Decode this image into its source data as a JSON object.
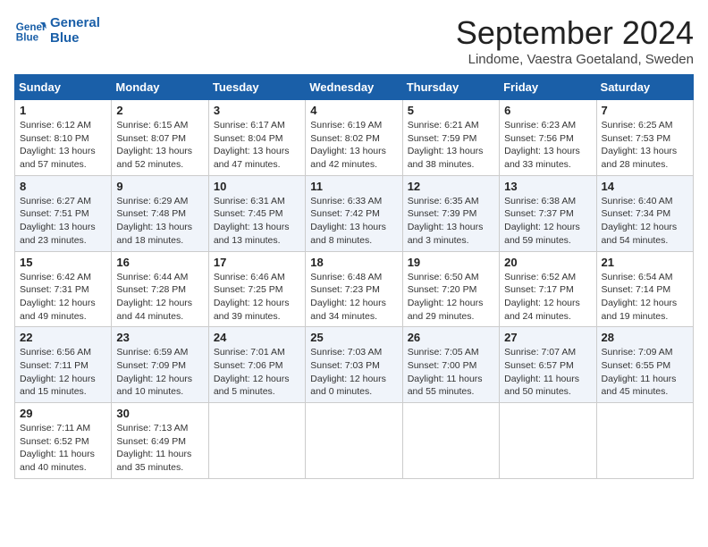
{
  "header": {
    "logo_line1": "General",
    "logo_line2": "Blue",
    "month": "September 2024",
    "location": "Lindome, Vaestra Goetaland, Sweden"
  },
  "weekdays": [
    "Sunday",
    "Monday",
    "Tuesday",
    "Wednesday",
    "Thursday",
    "Friday",
    "Saturday"
  ],
  "weeks": [
    [
      {
        "day": "1",
        "sunrise": "6:12 AM",
        "sunset": "8:10 PM",
        "daylight": "13 hours and 57 minutes."
      },
      {
        "day": "2",
        "sunrise": "6:15 AM",
        "sunset": "8:07 PM",
        "daylight": "13 hours and 52 minutes."
      },
      {
        "day": "3",
        "sunrise": "6:17 AM",
        "sunset": "8:04 PM",
        "daylight": "13 hours and 47 minutes."
      },
      {
        "day": "4",
        "sunrise": "6:19 AM",
        "sunset": "8:02 PM",
        "daylight": "13 hours and 42 minutes."
      },
      {
        "day": "5",
        "sunrise": "6:21 AM",
        "sunset": "7:59 PM",
        "daylight": "13 hours and 38 minutes."
      },
      {
        "day": "6",
        "sunrise": "6:23 AM",
        "sunset": "7:56 PM",
        "daylight": "13 hours and 33 minutes."
      },
      {
        "day": "7",
        "sunrise": "6:25 AM",
        "sunset": "7:53 PM",
        "daylight": "13 hours and 28 minutes."
      }
    ],
    [
      {
        "day": "8",
        "sunrise": "6:27 AM",
        "sunset": "7:51 PM",
        "daylight": "13 hours and 23 minutes."
      },
      {
        "day": "9",
        "sunrise": "6:29 AM",
        "sunset": "7:48 PM",
        "daylight": "13 hours and 18 minutes."
      },
      {
        "day": "10",
        "sunrise": "6:31 AM",
        "sunset": "7:45 PM",
        "daylight": "13 hours and 13 minutes."
      },
      {
        "day": "11",
        "sunrise": "6:33 AM",
        "sunset": "7:42 PM",
        "daylight": "13 hours and 8 minutes."
      },
      {
        "day": "12",
        "sunrise": "6:35 AM",
        "sunset": "7:39 PM",
        "daylight": "13 hours and 3 minutes."
      },
      {
        "day": "13",
        "sunrise": "6:38 AM",
        "sunset": "7:37 PM",
        "daylight": "12 hours and 59 minutes."
      },
      {
        "day": "14",
        "sunrise": "6:40 AM",
        "sunset": "7:34 PM",
        "daylight": "12 hours and 54 minutes."
      }
    ],
    [
      {
        "day": "15",
        "sunrise": "6:42 AM",
        "sunset": "7:31 PM",
        "daylight": "12 hours and 49 minutes."
      },
      {
        "day": "16",
        "sunrise": "6:44 AM",
        "sunset": "7:28 PM",
        "daylight": "12 hours and 44 minutes."
      },
      {
        "day": "17",
        "sunrise": "6:46 AM",
        "sunset": "7:25 PM",
        "daylight": "12 hours and 39 minutes."
      },
      {
        "day": "18",
        "sunrise": "6:48 AM",
        "sunset": "7:23 PM",
        "daylight": "12 hours and 34 minutes."
      },
      {
        "day": "19",
        "sunrise": "6:50 AM",
        "sunset": "7:20 PM",
        "daylight": "12 hours and 29 minutes."
      },
      {
        "day": "20",
        "sunrise": "6:52 AM",
        "sunset": "7:17 PM",
        "daylight": "12 hours and 24 minutes."
      },
      {
        "day": "21",
        "sunrise": "6:54 AM",
        "sunset": "7:14 PM",
        "daylight": "12 hours and 19 minutes."
      }
    ],
    [
      {
        "day": "22",
        "sunrise": "6:56 AM",
        "sunset": "7:11 PM",
        "daylight": "12 hours and 15 minutes."
      },
      {
        "day": "23",
        "sunrise": "6:59 AM",
        "sunset": "7:09 PM",
        "daylight": "12 hours and 10 minutes."
      },
      {
        "day": "24",
        "sunrise": "7:01 AM",
        "sunset": "7:06 PM",
        "daylight": "12 hours and 5 minutes."
      },
      {
        "day": "25",
        "sunrise": "7:03 AM",
        "sunset": "7:03 PM",
        "daylight": "12 hours and 0 minutes."
      },
      {
        "day": "26",
        "sunrise": "7:05 AM",
        "sunset": "7:00 PM",
        "daylight": "11 hours and 55 minutes."
      },
      {
        "day": "27",
        "sunrise": "7:07 AM",
        "sunset": "6:57 PM",
        "daylight": "11 hours and 50 minutes."
      },
      {
        "day": "28",
        "sunrise": "7:09 AM",
        "sunset": "6:55 PM",
        "daylight": "11 hours and 45 minutes."
      }
    ],
    [
      {
        "day": "29",
        "sunrise": "7:11 AM",
        "sunset": "6:52 PM",
        "daylight": "11 hours and 40 minutes."
      },
      {
        "day": "30",
        "sunrise": "7:13 AM",
        "sunset": "6:49 PM",
        "daylight": "11 hours and 35 minutes."
      },
      null,
      null,
      null,
      null,
      null
    ]
  ]
}
